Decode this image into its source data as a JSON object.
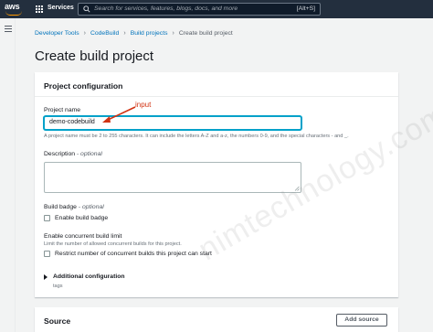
{
  "topbar": {
    "logo_text": "aws",
    "services_label": "Services",
    "search_placeholder": "Search for services, features, blogs, docs, and more",
    "search_shortcut": "[Alt+S]"
  },
  "breadcrumb": {
    "items": [
      "Developer Tools",
      "CodeBuild",
      "Build projects"
    ],
    "current": "Create build project"
  },
  "page_title": "Create build project",
  "project_configuration": {
    "title": "Project configuration",
    "project_name_label": "Project name",
    "project_name_value": "demo-codebuild",
    "project_name_hint": "A project name must be 2 to 255 characters. It can include the letters A-Z and a-z, the numbers 0-9, and the special characters - and _.",
    "description_label": "Description",
    "optional": "optional",
    "build_badge_label": "Build badge",
    "enable_build_badge": "Enable build badge",
    "concurrent_limit_label": "Enable concurrent build limit",
    "concurrent_limit_hint": "Limit the number of allowed concurrent builds for this project.",
    "restrict_concurrent": "Restrict number of concurrent builds this project can start",
    "additional_configuration": "Additional configuration",
    "additional_configuration_sub": "tags"
  },
  "source": {
    "title": "Source",
    "add_source_button": "Add source"
  },
  "annotation": {
    "text": "input",
    "color": "#d13212"
  },
  "watermark": "nimtechnology.com",
  "colors": {
    "topbar": "#232f3e",
    "accent": "#ff9900",
    "link": "#0073bb",
    "focus": "#00a1c9"
  }
}
